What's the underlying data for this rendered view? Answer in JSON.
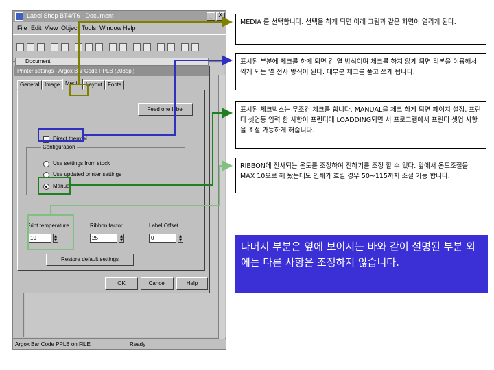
{
  "app": {
    "title": "Label Shop BT4/T6 - Document",
    "minimize": "_",
    "close": "X"
  },
  "menu": [
    "File",
    "Edit",
    "View",
    "Object",
    "Tools",
    "Window",
    "Help"
  ],
  "document": {
    "title": "Document"
  },
  "dialog": {
    "title": "Printer settings - Argox Bar Code PPLB (203dpi)",
    "tabs": [
      "General",
      "Image",
      "Media",
      "Layout",
      "Fonts"
    ],
    "active_tab": "Media",
    "feed_button": "Feed one label",
    "direct_thermal_label": "Direct thermal",
    "configuration_label": "Configuration",
    "radio_options": [
      "Use settings from stock",
      "Use updated printer settings",
      "Manual"
    ],
    "selected_radio": "Manual",
    "print_temperature_label": "Print temperature",
    "print_temperature_value": "10",
    "ribbon_factor_label": "Ribbon factor",
    "ribbon_factor_value": "25",
    "label_offset_label": "Label Offset",
    "label_offset_value": "0",
    "restore_button": "Restore default settings",
    "ok_button": "OK",
    "cancel_button": "Cancel",
    "help_button": "Help"
  },
  "status": {
    "printer": "Argox Bar Code PPLB on FILE",
    "state": "Ready"
  },
  "notes": {
    "media": "MEDIA 를 선택합니다. 선택을 하게 되면 아래 그림과 같은 화면이 열리게 된다.",
    "direct_thermal": "표시된 부분에 체크를 하게 되면 감 열 방식이며 체크를 하지 않게 되면 리본을 이용해서 찍게 되는 열 전사 방식이 된다. 대부분 체크를 풀고 쓰게 됩니다.",
    "manual": "표시된 체크박스는 무조건 체크를 합니다. MANUAL을 체크 하게 되면 페이지 설정, 프린터 셋업등 입력 한 사항이 프린터에 LOADDING되면 서 프로그램에서 프린터 셋업 사항을 조절 가능하게 해줍니다.",
    "temperature": "RIBBON에 전사되는 온도를 조정하여 진하기를 조정 할 수 있다. 앞에서 온도조절을 MAX 10으로 해 놨는데도 인쇄가 흐릴 경우 50~115까지 조절 가능 합니다.",
    "summary": "나머지 부분은 옆에 보이시는 바와 같이 설명된 부분 외에는 다른 사항은 조정하지 않습니다."
  },
  "colors": {
    "note_olive": "#808000",
    "note_blue": "#3030c0",
    "note_green": "#208020",
    "note_lime": "#80c080",
    "summary_bg": "#3b2fd6"
  }
}
